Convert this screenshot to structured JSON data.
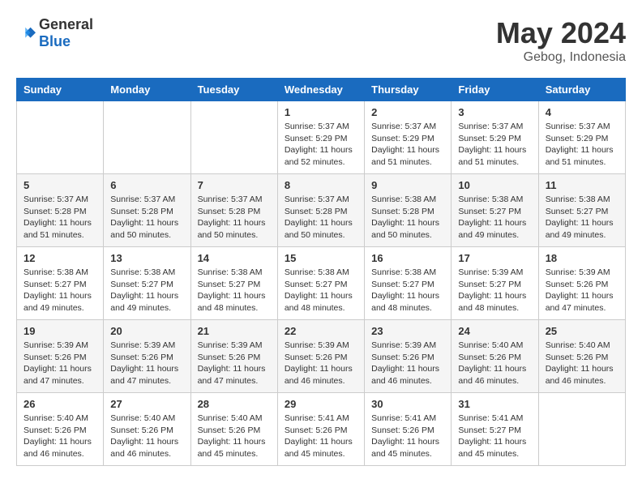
{
  "logo": {
    "general": "General",
    "blue": "Blue"
  },
  "title": {
    "month": "May 2024",
    "location": "Gebog, Indonesia"
  },
  "weekdays": [
    "Sunday",
    "Monday",
    "Tuesday",
    "Wednesday",
    "Thursday",
    "Friday",
    "Saturday"
  ],
  "weeks": [
    [
      {
        "day": "",
        "info": ""
      },
      {
        "day": "",
        "info": ""
      },
      {
        "day": "",
        "info": ""
      },
      {
        "day": "1",
        "info": "Sunrise: 5:37 AM\nSunset: 5:29 PM\nDaylight: 11 hours\nand 52 minutes."
      },
      {
        "day": "2",
        "info": "Sunrise: 5:37 AM\nSunset: 5:29 PM\nDaylight: 11 hours\nand 51 minutes."
      },
      {
        "day": "3",
        "info": "Sunrise: 5:37 AM\nSunset: 5:29 PM\nDaylight: 11 hours\nand 51 minutes."
      },
      {
        "day": "4",
        "info": "Sunrise: 5:37 AM\nSunset: 5:29 PM\nDaylight: 11 hours\nand 51 minutes."
      }
    ],
    [
      {
        "day": "5",
        "info": "Sunrise: 5:37 AM\nSunset: 5:28 PM\nDaylight: 11 hours\nand 51 minutes."
      },
      {
        "day": "6",
        "info": "Sunrise: 5:37 AM\nSunset: 5:28 PM\nDaylight: 11 hours\nand 50 minutes."
      },
      {
        "day": "7",
        "info": "Sunrise: 5:37 AM\nSunset: 5:28 PM\nDaylight: 11 hours\nand 50 minutes."
      },
      {
        "day": "8",
        "info": "Sunrise: 5:37 AM\nSunset: 5:28 PM\nDaylight: 11 hours\nand 50 minutes."
      },
      {
        "day": "9",
        "info": "Sunrise: 5:38 AM\nSunset: 5:28 PM\nDaylight: 11 hours\nand 50 minutes."
      },
      {
        "day": "10",
        "info": "Sunrise: 5:38 AM\nSunset: 5:27 PM\nDaylight: 11 hours\nand 49 minutes."
      },
      {
        "day": "11",
        "info": "Sunrise: 5:38 AM\nSunset: 5:27 PM\nDaylight: 11 hours\nand 49 minutes."
      }
    ],
    [
      {
        "day": "12",
        "info": "Sunrise: 5:38 AM\nSunset: 5:27 PM\nDaylight: 11 hours\nand 49 minutes."
      },
      {
        "day": "13",
        "info": "Sunrise: 5:38 AM\nSunset: 5:27 PM\nDaylight: 11 hours\nand 49 minutes."
      },
      {
        "day": "14",
        "info": "Sunrise: 5:38 AM\nSunset: 5:27 PM\nDaylight: 11 hours\nand 48 minutes."
      },
      {
        "day": "15",
        "info": "Sunrise: 5:38 AM\nSunset: 5:27 PM\nDaylight: 11 hours\nand 48 minutes."
      },
      {
        "day": "16",
        "info": "Sunrise: 5:38 AM\nSunset: 5:27 PM\nDaylight: 11 hours\nand 48 minutes."
      },
      {
        "day": "17",
        "info": "Sunrise: 5:39 AM\nSunset: 5:27 PM\nDaylight: 11 hours\nand 48 minutes."
      },
      {
        "day": "18",
        "info": "Sunrise: 5:39 AM\nSunset: 5:26 PM\nDaylight: 11 hours\nand 47 minutes."
      }
    ],
    [
      {
        "day": "19",
        "info": "Sunrise: 5:39 AM\nSunset: 5:26 PM\nDaylight: 11 hours\nand 47 minutes."
      },
      {
        "day": "20",
        "info": "Sunrise: 5:39 AM\nSunset: 5:26 PM\nDaylight: 11 hours\nand 47 minutes."
      },
      {
        "day": "21",
        "info": "Sunrise: 5:39 AM\nSunset: 5:26 PM\nDaylight: 11 hours\nand 47 minutes."
      },
      {
        "day": "22",
        "info": "Sunrise: 5:39 AM\nSunset: 5:26 PM\nDaylight: 11 hours\nand 46 minutes."
      },
      {
        "day": "23",
        "info": "Sunrise: 5:39 AM\nSunset: 5:26 PM\nDaylight: 11 hours\nand 46 minutes."
      },
      {
        "day": "24",
        "info": "Sunrise: 5:40 AM\nSunset: 5:26 PM\nDaylight: 11 hours\nand 46 minutes."
      },
      {
        "day": "25",
        "info": "Sunrise: 5:40 AM\nSunset: 5:26 PM\nDaylight: 11 hours\nand 46 minutes."
      }
    ],
    [
      {
        "day": "26",
        "info": "Sunrise: 5:40 AM\nSunset: 5:26 PM\nDaylight: 11 hours\nand 46 minutes."
      },
      {
        "day": "27",
        "info": "Sunrise: 5:40 AM\nSunset: 5:26 PM\nDaylight: 11 hours\nand 46 minutes."
      },
      {
        "day": "28",
        "info": "Sunrise: 5:40 AM\nSunset: 5:26 PM\nDaylight: 11 hours\nand 45 minutes."
      },
      {
        "day": "29",
        "info": "Sunrise: 5:41 AM\nSunset: 5:26 PM\nDaylight: 11 hours\nand 45 minutes."
      },
      {
        "day": "30",
        "info": "Sunrise: 5:41 AM\nSunset: 5:26 PM\nDaylight: 11 hours\nand 45 minutes."
      },
      {
        "day": "31",
        "info": "Sunrise: 5:41 AM\nSunset: 5:27 PM\nDaylight: 11 hours\nand 45 minutes."
      },
      {
        "day": "",
        "info": ""
      }
    ]
  ]
}
